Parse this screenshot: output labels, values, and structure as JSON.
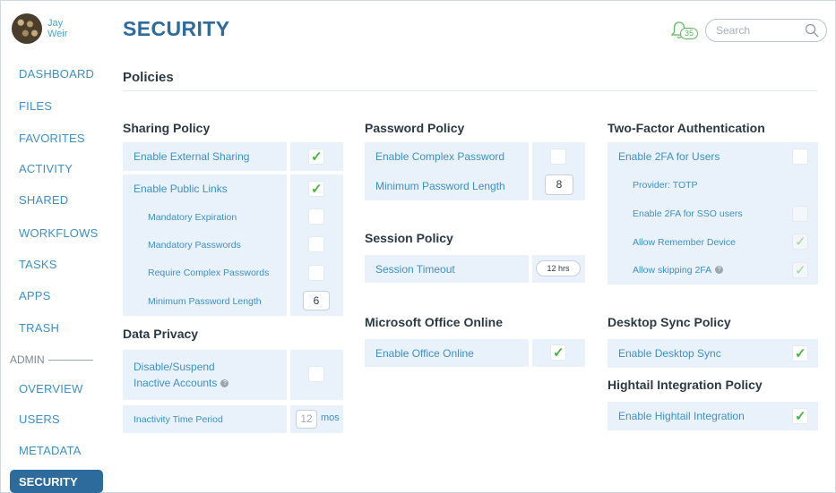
{
  "user": {
    "first_name": "Jay",
    "last_name": "Weir"
  },
  "sidebar": {
    "items": [
      "DASHBOARD",
      "FILES",
      "FAVORITES",
      "ACTIVITY",
      "SHARED",
      "WORKFLOWS",
      "TASKS",
      "APPS",
      "TRASH"
    ],
    "admin_label": "ADMIN",
    "admin_items": [
      "OVERVIEW",
      "USERS",
      "METADATA",
      "SECURITY"
    ],
    "active": "SECURITY"
  },
  "header": {
    "title": "SECURITY",
    "notification_count": "35",
    "search_placeholder": "Search"
  },
  "subheader": "Policies",
  "sharing": {
    "title": "Sharing Policy",
    "external_sharing": {
      "label": "Enable External Sharing",
      "checked": true
    },
    "public_links": {
      "label": "Enable Public Links",
      "checked": true
    },
    "mandatory_expiration": {
      "label": "Mandatory Expiration",
      "checked": false
    },
    "mandatory_passwords": {
      "label": "Mandatory Passwords",
      "checked": false
    },
    "require_complex": {
      "label": "Require Complex Passwords",
      "checked": false
    },
    "min_length": {
      "label": "Minimum Password Length",
      "value": "6"
    }
  },
  "privacy": {
    "title": "Data Privacy",
    "disable_inactive": {
      "label": "Disable/Suspend Inactive Accounts",
      "checked": false
    },
    "inactivity_period": {
      "label": "Inactivity Time Period",
      "value": "12",
      "unit": "mos"
    }
  },
  "password": {
    "title": "Password Policy",
    "complex": {
      "label": "Enable Complex Password",
      "checked": false
    },
    "min_length": {
      "label": "Minimum Password Length",
      "value": "8"
    }
  },
  "session": {
    "title": "Session Policy",
    "timeout": {
      "label": "Session Timeout",
      "value": "12 hrs"
    }
  },
  "office": {
    "title": "Microsoft Office Online",
    "enable": {
      "label": "Enable Office Online",
      "checked": true
    }
  },
  "twofa": {
    "title": "Two-Factor Authentication",
    "enable": {
      "label": "Enable 2FA for Users",
      "checked": false
    },
    "provider": "Provider: TOTP",
    "sso": {
      "label": "Enable 2FA for SSO users",
      "checked": false
    },
    "remember": {
      "label": "Allow Remember Device",
      "checked": true
    },
    "skipping": {
      "label": "Allow skipping 2FA",
      "checked": true
    }
  },
  "desktop": {
    "title": "Desktop Sync Policy",
    "enable": {
      "label": "Enable Desktop Sync",
      "checked": true
    }
  },
  "hightail": {
    "title": "Hightail Integration Policy",
    "enable": {
      "label": "Enable Hightail Integration",
      "checked": true
    }
  },
  "colors": {
    "accent": "#2d6b9d",
    "link": "#3d90c7",
    "row_bg": "#e9f2fa",
    "check": "#4bb344"
  }
}
